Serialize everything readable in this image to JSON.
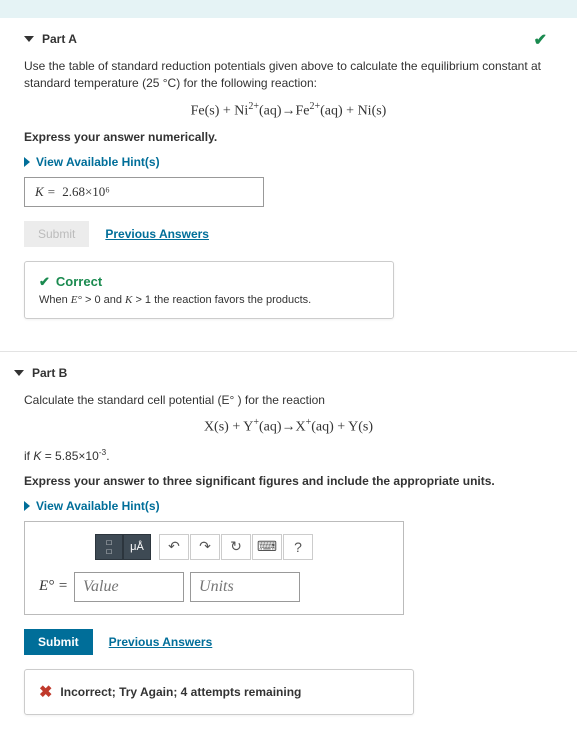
{
  "partA": {
    "title": "Part A",
    "prompt1": "Use the table of standard reduction potentials given above to calculate the equilibrium constant at standard temperature (25 °C) for the following reaction:",
    "equation_html": "Fe(s) + Ni<sup>2+</sup>(aq)→Fe<sup>2+</sup>(aq) + Ni(s)",
    "instruction": "Express your answer numerically.",
    "hint_label": "View Available Hint(s)",
    "answer_prefix": "K =",
    "answer_value": "2.68×10⁶",
    "submit_label": "Submit",
    "prev_answers_label": "Previous Answers",
    "feedback_head": "Correct",
    "feedback_text_html": "When <span class='math'>E°</span> &gt; 0 and <span class='math'>K</span> &gt; 1 the reaction favors the products."
  },
  "partB": {
    "title": "Part B",
    "prompt1": "Calculate the standard cell potential (E° ) for the reaction",
    "equation_html": "X(s) + Y<sup>+</sup>(aq)→X<sup>+</sup>(aq) + Y(s)",
    "condition_html": "if <i>K</i> = 5.85×10<sup>-3</sup>.",
    "instruction": "Express your answer to three significant figures and include the appropriate units.",
    "hint_label": "View Available Hint(s)",
    "toolbar": {
      "unit_btn": "μÅ",
      "undo": "↶",
      "redo": "↷",
      "reset": "↻",
      "keyboard": "⌨",
      "help": "?"
    },
    "input_label": "E°  =",
    "value_placeholder": "Value",
    "units_placeholder": "Units",
    "submit_label": "Submit",
    "prev_answers_label": "Previous Answers",
    "feedback_text": "Incorrect; Try Again; 4 attempts remaining"
  }
}
